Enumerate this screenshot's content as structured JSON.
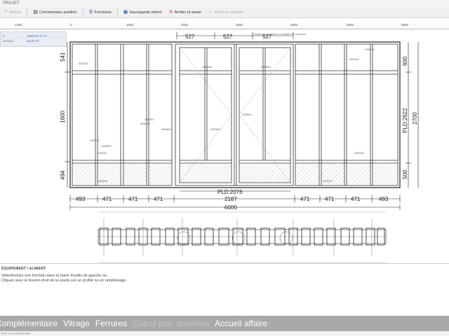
{
  "window": {
    "title": "PROJET"
  },
  "toolbar": {
    "items": [
      {
        "label": "Retour",
        "icon": "undo-icon",
        "enabled": false
      },
      {
        "label": "Commentaire position",
        "icon": "comment-icon",
        "enabled": true
      },
      {
        "label": "Fonctions",
        "icon": "gear-icon",
        "enabled": true
      },
      {
        "label": "Sauvegarde interm",
        "icon": "save-icon",
        "enabled": true
      },
      {
        "label": "Arrêter la saisie",
        "icon": "close-icon",
        "enabled": true
      },
      {
        "label": "Terminer position",
        "icon": "check-icon",
        "enabled": false
      }
    ]
  },
  "ruler": {
    "ticks": [
      "-1000",
      "0",
      "1000",
      "2000",
      "3000",
      "4000",
      "5000",
      "6000"
    ]
  },
  "properties": {
    "row1": {
      "label": "0",
      "value": "1896.60 m²/°C"
    },
    "row2": {
      "label": "Surface",
      "value": "16.20 m²"
    }
  },
  "drawing": {
    "top_dims": [
      "527",
      "527",
      "527"
    ],
    "top_right_label": "Position de l'ouverture / Protection de l'ouverture",
    "left_dims": [
      "541",
      "1600",
      "494"
    ],
    "right_dims": {
      "top": "600",
      "pld": "PLD:2622",
      "total": "2700",
      "bottom": "500"
    },
    "pld_bottom": "PLD:2076",
    "bottom_segments": [
      "493",
      "471",
      "471",
      "471",
      "2187",
      "471",
      "471",
      "471",
      "493"
    ],
    "total_width": "6000",
    "panel_codes": [
      "4031223",
      "4030223",
      "4030226",
      "4030208",
      "4032026",
      "4030223",
      "4030514",
      "4030514",
      "4030616",
      "4030514",
      "4030223",
      "4030161",
      "4030226",
      "4030224",
      "4030514",
      "4030515"
    ]
  },
  "messages": {
    "title": "ÉQUIPEMENT / ALIMENT",
    "lines": [
      "Sélectionnez une fonction dans la barre d'outils de gauche ou",
      "Cliquez avec le bouton droit de la souris sur un profilé ou un remplissage."
    ]
  },
  "tabs": [
    {
      "label": "Complémentaire",
      "active": true
    },
    {
      "label": "Vitrage",
      "active": true
    },
    {
      "label": "Ferrures",
      "active": true
    },
    {
      "label": "Calcul pos. données",
      "active": false
    },
    {
      "label": "Accueil affaire",
      "active": true
    }
  ],
  "status": {
    "text": "Prof 1.8 STANDARD"
  }
}
